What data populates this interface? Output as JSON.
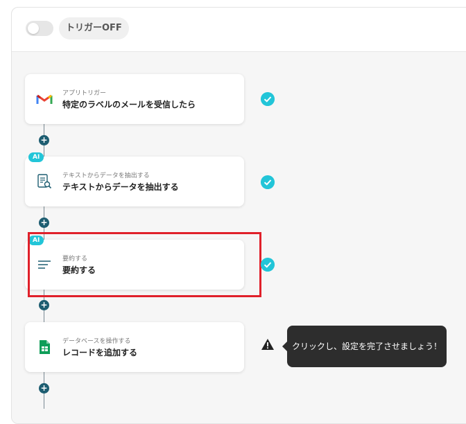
{
  "header": {
    "toggle_label": "トリガーOFF",
    "toggle_on": false
  },
  "steps": [
    {
      "subtitle": "アプリトリガー",
      "title": "特定のラベルのメールを受信したら",
      "icon": "gmail-icon",
      "status": "complete"
    },
    {
      "badge": "AI",
      "subtitle": "テキストからデータを抽出する",
      "title": "テキストからデータを抽出する",
      "icon": "document-search-icon",
      "status": "complete"
    },
    {
      "badge": "AI",
      "subtitle": "要約する",
      "title": "要約する",
      "icon": "summary-lines-icon",
      "status": "complete"
    },
    {
      "subtitle": "データベースを操作する",
      "title": "レコードを追加する",
      "icon": "google-sheets-icon",
      "status": "warning"
    }
  ],
  "add_step_symbol": "+",
  "tooltip": {
    "text": "クリックし、設定を完了させましょう！"
  },
  "colors": {
    "accent": "#22c5d8",
    "connector": "#1d5d71",
    "highlight": "#e0202a",
    "tooltip_bg": "#2d2d2d"
  }
}
